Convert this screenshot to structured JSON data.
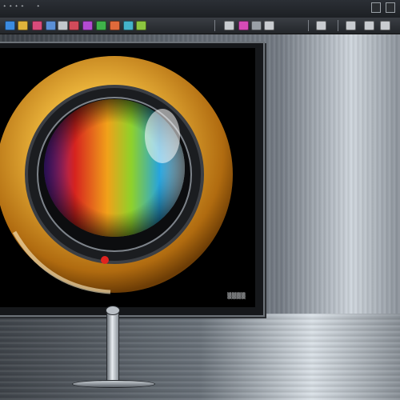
{
  "window": {
    "title": "ᐩ ᐩ ᐩ ᐩ",
    "menu": "᠎ᐩ"
  },
  "system_icons": [
    "window-icon",
    "close-icon"
  ],
  "toolbar": {
    "icons": [
      {
        "name": "folder-icon",
        "color": "#3b8be0"
      },
      {
        "name": "image-icon",
        "color": "#e0b43b"
      },
      {
        "name": "color-wheel-icon",
        "color": "#d94b7a"
      },
      {
        "name": "layers-icon",
        "color": "#5a8fd6"
      },
      {
        "name": "document-icon",
        "color": "#c2c7cc"
      },
      {
        "name": "frame-icon",
        "color": "#d24b5a"
      },
      {
        "name": "palette-icon",
        "color": "#b34bd2"
      },
      {
        "name": "leaf-icon",
        "color": "#3fb24a"
      },
      {
        "name": "brush-icon",
        "color": "#e06a3b"
      },
      {
        "name": "grid-icon",
        "color": "#44b3c9"
      },
      {
        "name": "eye-icon",
        "color": "#8cc63f"
      },
      {
        "name": "crop-icon",
        "color": "#c9ccd0"
      },
      {
        "name": "brush-tool-icon",
        "color": "#d64bb6"
      },
      {
        "name": "settings-icon",
        "color": "#9aa0a6"
      },
      {
        "name": "arrow-icon",
        "color": "#c9ccd0"
      },
      {
        "name": "flag-icon",
        "color": "#c9ccd0"
      },
      {
        "name": "save-icon",
        "color": "#c9ccd0"
      },
      {
        "name": "export-icon",
        "color": "#c9ccd0"
      },
      {
        "name": "share-icon",
        "color": "#c9ccd0"
      }
    ]
  },
  "monitor": {
    "brand": "▒▒▒▒"
  },
  "artwork": {
    "ring_color": "#d79a1f",
    "lens_colors": [
      "#6a2bd1",
      "#e0231f",
      "#f0a21a",
      "#7ed321",
      "#2fa6e0"
    ]
  }
}
